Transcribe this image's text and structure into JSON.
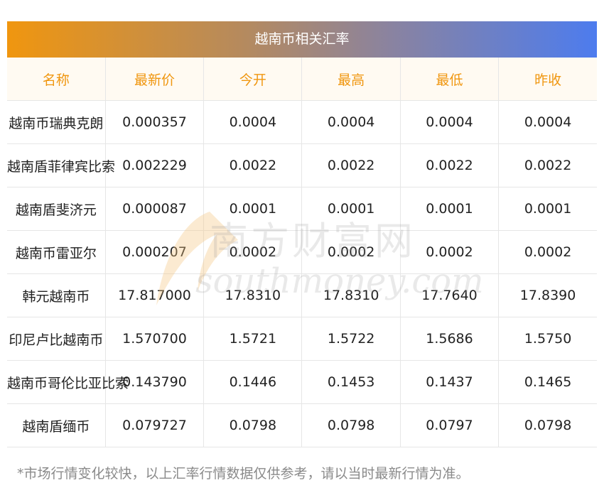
{
  "title": "越南币相关汇率",
  "columns": [
    "名称",
    "最新价",
    "今开",
    "最高",
    "最低",
    "昨收"
  ],
  "rows": [
    [
      "越南币瑞典克朗",
      "0.000357",
      "0.0004",
      "0.0004",
      "0.0004",
      "0.0004"
    ],
    [
      "越南盾菲律宾比索",
      "0.002229",
      "0.0022",
      "0.0022",
      "0.0022",
      "0.0022"
    ],
    [
      "越南盾斐济元",
      "0.000087",
      "0.0001",
      "0.0001",
      "0.0001",
      "0.0001"
    ],
    [
      "越南币雷亚尔",
      "0.000207",
      "0.0002",
      "0.0002",
      "0.0002",
      "0.0002"
    ],
    [
      "韩元越南币",
      "17.817000",
      "17.8310",
      "17.8310",
      "17.7640",
      "17.8390"
    ],
    [
      "印尼卢比越南币",
      "1.570700",
      "1.5721",
      "1.5722",
      "1.5686",
      "1.5750"
    ],
    [
      "越南币哥伦比亚比索",
      "0.143790",
      "0.1446",
      "0.1453",
      "0.1437",
      "0.1465"
    ],
    [
      "越南盾缅币",
      "0.079727",
      "0.0798",
      "0.0798",
      "0.0797",
      "0.0798"
    ]
  ],
  "note": "*市场行情变化较快，以上汇率行情数据仅供参考，请以当时最新行情为准。",
  "watermark": {
    "cn": "南方财富网",
    "en": "southmoney.com"
  },
  "colors": {
    "header_text": "#f0960f",
    "header_bg": "#fffaf2",
    "gradient_start": "#f0960f",
    "gradient_end": "#4d7cee"
  }
}
